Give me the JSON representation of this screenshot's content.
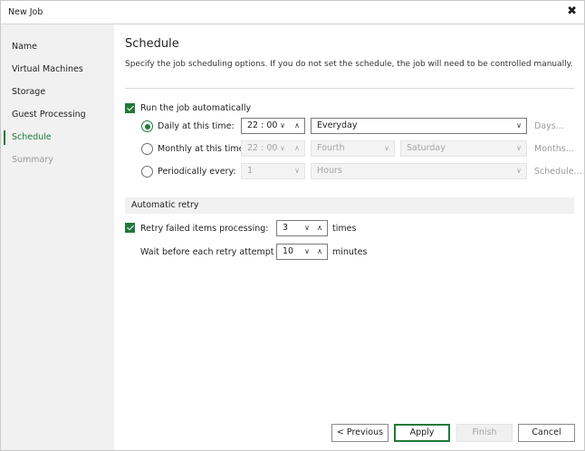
{
  "window": {
    "title": "New Job",
    "close_glyph": "✖"
  },
  "sidebar": {
    "items": [
      {
        "label": "Name"
      },
      {
        "label": "Virtual Machines"
      },
      {
        "label": "Storage"
      },
      {
        "label": "Guest Processing"
      },
      {
        "label": "Schedule",
        "state": "active"
      },
      {
        "label": "Summary",
        "state": "disabled"
      }
    ]
  },
  "page": {
    "title": "Schedule",
    "description": "Specify the job scheduling options. If you do not set the schedule, the job will need to be controlled manually."
  },
  "schedule": {
    "run_auto": {
      "label": "Run the job automatically",
      "checked": true
    },
    "daily": {
      "label": "Daily at this time:",
      "selected": true,
      "time": "22 : 00",
      "frequency": "Everyday",
      "link": "Days..."
    },
    "monthly": {
      "label": "Monthly at this time:",
      "selected": false,
      "time": "22 : 00",
      "week": "Fourth",
      "day": "Saturday",
      "link": "Months..."
    },
    "periodic": {
      "label": "Periodically every:",
      "selected": false,
      "value": "1",
      "unit": "Hours",
      "link": "Schedule..."
    }
  },
  "retry": {
    "section_title": "Automatic retry",
    "retry_failed": {
      "label": "Retry failed items processing:",
      "checked": true,
      "value": "3",
      "unit": "times"
    },
    "wait": {
      "label": "Wait before each retry attempt for:",
      "value": "10",
      "unit": "minutes"
    }
  },
  "footer": {
    "previous": "< Previous",
    "apply": "Apply",
    "finish": "Finish",
    "cancel": "Cancel"
  },
  "colors": {
    "accent": "#1f7a3a",
    "sidebar_bg": "#f1f1f1",
    "disabled_text": "#a5a5a5"
  },
  "icons": {
    "dropdown": "chevron-down-icon",
    "spin_up": "chevron-up-icon",
    "close": "close-icon",
    "check": "checkmark-icon"
  }
}
